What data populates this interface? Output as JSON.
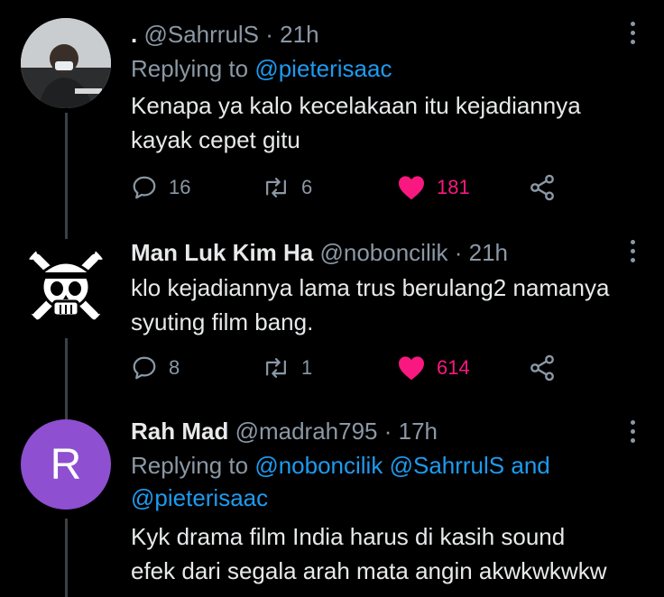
{
  "tweets": [
    {
      "name": ".",
      "handle": "@SahrrulS",
      "time": "· 21h",
      "replying_prefix": "Replying to",
      "replying_to": "@pieterisaac",
      "text_lines": [
        "Kenapa ya kalo kecelakaan itu kejadiannya",
        "kayak cepet gitu"
      ],
      "replies": "16",
      "retweets": "6",
      "likes": "181"
    },
    {
      "name": "Man Luk Kim Ha",
      "handle": "@noboncilik",
      "time": "· 21h",
      "text_lines": [
        "klo kejadiannya lama trus berulang2 namanya",
        "syuting film bang."
      ],
      "replies": "8",
      "retweets": "1",
      "likes": "614"
    },
    {
      "name": "Rah Mad",
      "handle": "@madrah795",
      "time": "· 17h",
      "avatar_letter": "R",
      "replying_prefix": "Replying to",
      "replying_to_1": "@noboncilik",
      "replying_to_2": "@SahrrulS",
      "replying_and": "and",
      "replying_to_3": "@pieterisaac",
      "text_lines": [
        "Kyk drama film India harus di kasih sound",
        "efek dari segala arah mata angin akwkwkwkw"
      ]
    }
  ],
  "colors": {
    "background": "#000000",
    "text": "#e7e9ea",
    "secondary": "#8b98a5",
    "link": "#1d9bf0",
    "like": "#f91880",
    "avatar_r": "#8e4fd0"
  },
  "icons": [
    "reply-icon",
    "retweet-icon",
    "heart-icon",
    "share-icon",
    "more-icon"
  ]
}
